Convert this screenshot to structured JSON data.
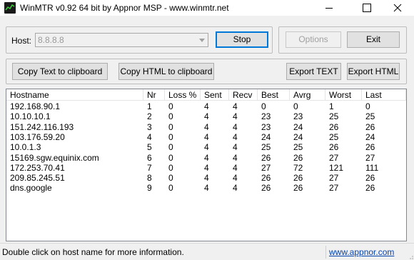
{
  "window": {
    "title": "WinMTR v0.92 64 bit by Appnor MSP - www.winmtr.net"
  },
  "host": {
    "label": "Host:",
    "value": "8.8.8.8"
  },
  "buttons": {
    "stop": "Stop",
    "options": "Options",
    "exit": "Exit",
    "copy_text": "Copy Text to clipboard",
    "copy_html": "Copy HTML to clipboard",
    "export_text": "Export TEXT",
    "export_html": "Export HTML"
  },
  "table": {
    "columns": [
      "Hostname",
      "Nr",
      "Loss %",
      "Sent",
      "Recv",
      "Best",
      "Avrg",
      "Worst",
      "Last"
    ],
    "rows": [
      [
        "192.168.90.1",
        "1",
        "0",
        "4",
        "4",
        "0",
        "0",
        "1",
        "0"
      ],
      [
        "10.10.10.1",
        "2",
        "0",
        "4",
        "4",
        "23",
        "23",
        "25",
        "25"
      ],
      [
        "151.242.116.193",
        "3",
        "0",
        "4",
        "4",
        "23",
        "24",
        "26",
        "26"
      ],
      [
        "103.176.59.20",
        "4",
        "0",
        "4",
        "4",
        "24",
        "24",
        "25",
        "24"
      ],
      [
        "10.0.1.3",
        "5",
        "0",
        "4",
        "4",
        "25",
        "25",
        "26",
        "26"
      ],
      [
        "15169.sgw.equinix.com",
        "6",
        "0",
        "4",
        "4",
        "26",
        "26",
        "27",
        "27"
      ],
      [
        "172.253.70.41",
        "7",
        "0",
        "4",
        "4",
        "27",
        "72",
        "121",
        "111"
      ],
      [
        "209.85.245.51",
        "8",
        "0",
        "4",
        "4",
        "26",
        "26",
        "27",
        "26"
      ],
      [
        "dns.google",
        "9",
        "0",
        "4",
        "4",
        "26",
        "26",
        "27",
        "26"
      ]
    ]
  },
  "status": {
    "message": "Double click on host name for more information.",
    "link": "www.appnor.com"
  },
  "icons": {
    "app": "winmtr-app-icon",
    "minimize": "minimize-icon",
    "maximize": "maximize-icon",
    "close": "close-icon",
    "dropdown": "chevron-down-icon"
  },
  "colors": {
    "focus_border": "#0078d7",
    "link": "#0645ad"
  }
}
